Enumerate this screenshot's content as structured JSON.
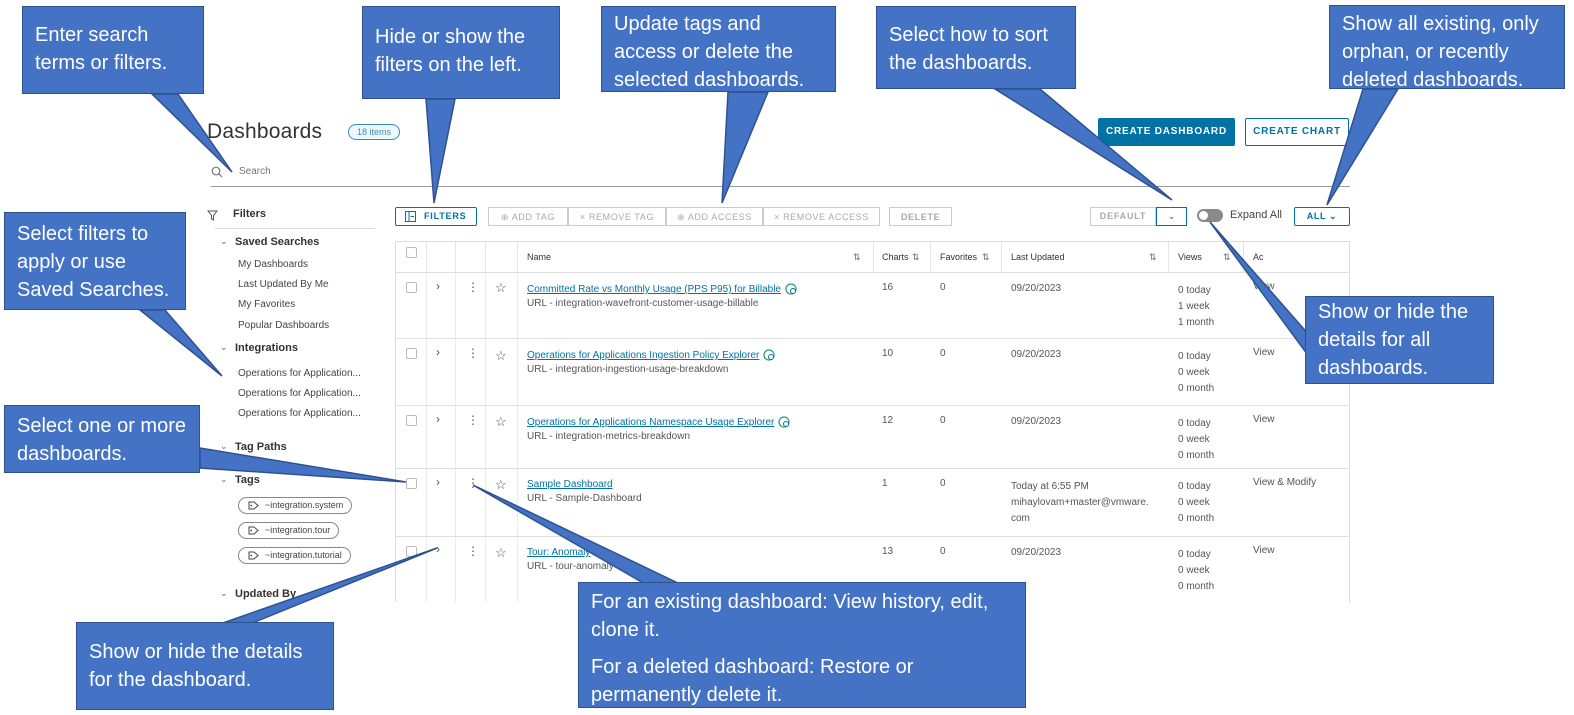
{
  "header": {
    "title": "Dashboards",
    "count": "18 items",
    "create_dashboard": "CREATE DASHBOARD",
    "create_chart": "CREATE CHART"
  },
  "search": {
    "placeholder": "Search"
  },
  "sidebar": {
    "heading": "Filters",
    "saved_searches": {
      "label": "Saved Searches",
      "items": [
        "My Dashboards",
        "Last Updated By Me",
        "My Favorites",
        "Popular Dashboards"
      ]
    },
    "integrations": {
      "label": "Integrations",
      "items": [
        "Operations for Application...",
        "Operations for Application...",
        "Operations for Application..."
      ]
    },
    "tag_paths": {
      "label": "Tag Paths"
    },
    "tags": {
      "label": "Tags",
      "items": [
        "~integration.system",
        "~integration.tour",
        "~integration.tutorial"
      ]
    },
    "updated_by": {
      "label": "Updated By"
    }
  },
  "toolbar": {
    "filters": "FILTERS",
    "add_tag": "ADD TAG",
    "remove_tag": "REMOVE TAG",
    "add_access": "ADD ACCESS",
    "remove_access": "REMOVE ACCESS",
    "delete": "DELETE",
    "sort_default": "DEFAULT",
    "expand_all": "Expand All",
    "all": "ALL"
  },
  "table": {
    "columns": {
      "name": "Name",
      "charts": "Charts",
      "favorites": "Favorites",
      "last_updated": "Last Updated",
      "views": "Views",
      "access": "Ac"
    },
    "rows": [
      {
        "name": "Committed Rate vs Monthly Usage (PPS P95) for Billable",
        "url": "URL - integration-wavefront-customer-usage-billable",
        "charts": "16",
        "favorites": "0",
        "updated": "09/20/2023",
        "updated_by": "",
        "views": [
          "0 today",
          "1 week",
          "1 month"
        ],
        "access": "View"
      },
      {
        "name": "Operations for Applications Ingestion Policy Explorer",
        "url": "URL - integration-ingestion-usage-breakdown",
        "charts": "10",
        "favorites": "0",
        "updated": "09/20/2023",
        "updated_by": "",
        "views": [
          "0 today",
          "0 week",
          "0 month"
        ],
        "access": "View"
      },
      {
        "name": "Operations for Applications Namespace Usage Explorer",
        "url": "URL - integration-metrics-breakdown",
        "charts": "12",
        "favorites": "0",
        "updated": "09/20/2023",
        "updated_by": "",
        "views": [
          "0 today",
          "0 week",
          "0 month"
        ],
        "access": "View"
      },
      {
        "name": "Sample Dashboard",
        "url": "URL - Sample-Dashboard",
        "charts": "1",
        "favorites": "0",
        "updated": "Today at 6:55 PM",
        "updated_by": "mihaylovam+master@vmware.",
        "updated_by2": "com",
        "views": [
          "0 today",
          "0 week",
          "0 month"
        ],
        "access": "View & Modify"
      },
      {
        "name": "Tour: Anomaly",
        "url": "URL - tour-anomaly",
        "charts": "13",
        "favorites": "0",
        "updated": "09/20/2023",
        "updated_by": "",
        "views": [
          "0 today",
          "0 week",
          "0 month"
        ],
        "access": "View"
      }
    ]
  },
  "callouts": {
    "search": "Enter search terms or filters.",
    "filters_toggle": "Hide or show  the filters on the left.",
    "bulk": "Update tags and access or delete the selected dashboards.",
    "sort": "Select how to sort the dashboards.",
    "all": "Show all existing, only orphan, or recently deleted dashboards.",
    "sidebar": "Select filters to apply or use Saved Searches.",
    "expand": "Show or hide the details for all dashboards.",
    "select": "Select one or more dashboards.",
    "details": "Show or hide the details for the dashboard.",
    "menu_existing": "For an existing dashboard: View history, edit, clone it.",
    "menu_deleted": "For a deleted dashboard: Restore or permanently delete it."
  },
  "colors": {
    "callout": "#4472c4",
    "accent": "#0072a3"
  }
}
